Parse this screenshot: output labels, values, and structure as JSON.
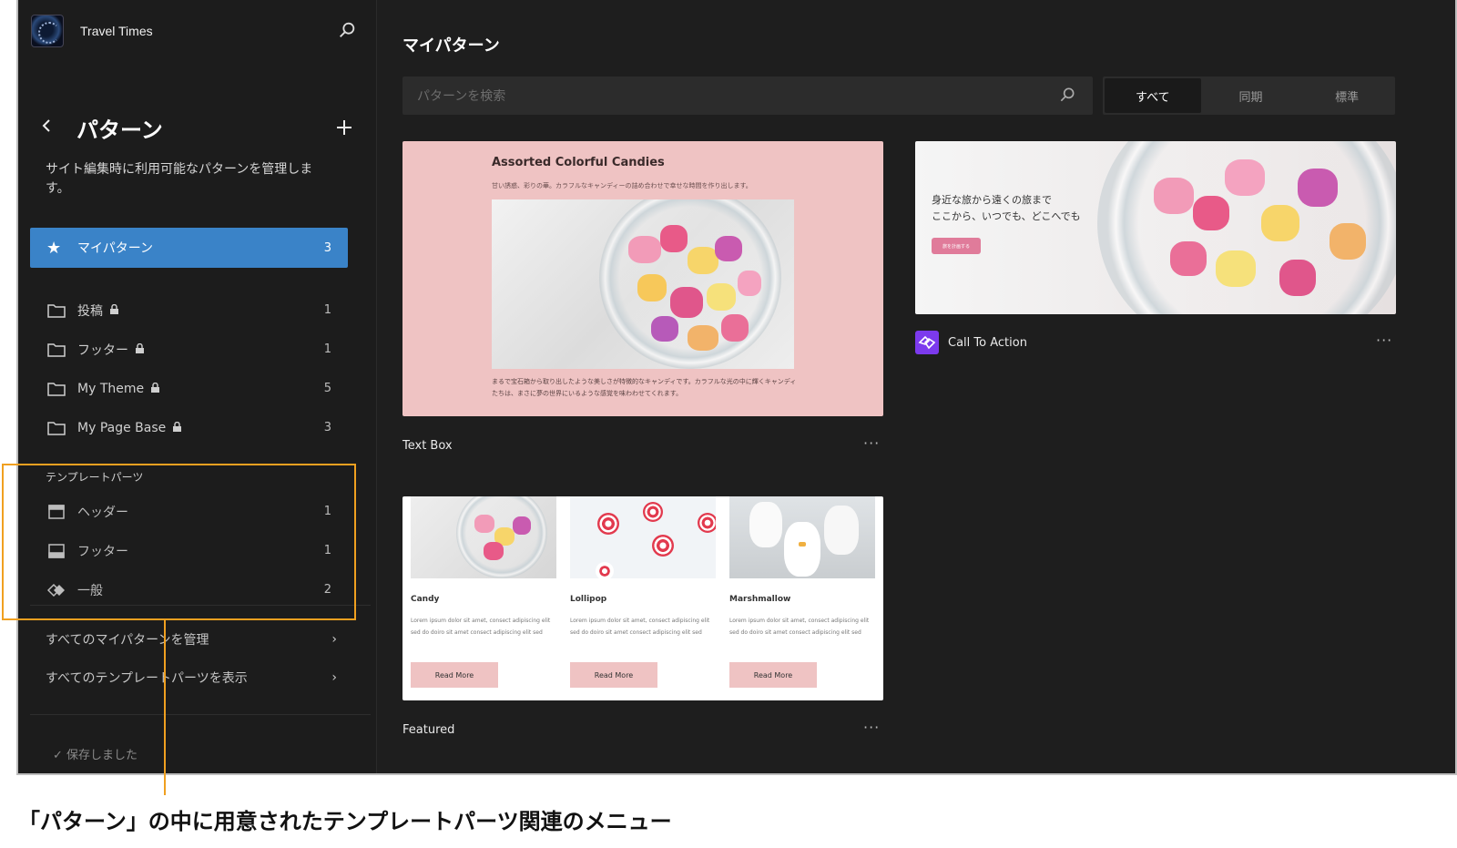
{
  "site": {
    "name": "Travel Times"
  },
  "panel": {
    "title": "パターン",
    "description": "サイト編集時に利用可能なパターンを管理します。"
  },
  "my_patterns": {
    "label": "マイパターン",
    "count": "3"
  },
  "categories": [
    {
      "label": "投稿",
      "count": "1",
      "locked": true
    },
    {
      "label": "フッター",
      "count": "1",
      "locked": true
    },
    {
      "label": "My Theme",
      "count": "5",
      "locked": true
    },
    {
      "label": "My Page Base",
      "count": "3",
      "locked": true
    }
  ],
  "template_parts": {
    "heading": "テンプレートパーツ",
    "items": [
      {
        "label": "ヘッダー",
        "count": "1",
        "icon": "header-icon"
      },
      {
        "label": "フッター",
        "count": "1",
        "icon": "footer-icon"
      },
      {
        "label": "一般",
        "count": "2",
        "icon": "general-icon"
      }
    ]
  },
  "links": {
    "manage_patterns": "すべてのマイパターンを管理",
    "view_template_parts": "すべてのテンプレートパーツを表示"
  },
  "saved_status": "保存しました",
  "main": {
    "title": "マイパターン",
    "search_placeholder": "パターンを検索",
    "filters": [
      "すべて",
      "同期",
      "標準"
    ],
    "active_filter": "すべて"
  },
  "cards": {
    "text_box": {
      "label": "Text Box",
      "preview_title": "Assorted Colorful Candies",
      "preview_subtitle": "甘い誘惑、彩りの華。カラフルなキャンディーの詰め合わせで幸せな時間を作り出します。",
      "preview_footer": "まるで宝石箱から取り出したような美しさが特徴的なキャンディです。カラフルな光の中に輝くキャンディたちは、まさに夢の世界にいるような感覚を味わわせてくれます。"
    },
    "call_to_action": {
      "label": "Call To Action",
      "preview_line1": "身近な旅から遠くの旅まで",
      "preview_line2": "ここから、いつでも、どこへでも",
      "preview_button": "旅を計画する"
    },
    "featured": {
      "label": "Featured",
      "items": [
        {
          "title": "Candy",
          "text": "Lorem ipsum dolor sit amet, consect adipiscing elit sed do doiro sit amet consect adipiscing elit sed",
          "button": "Read More"
        },
        {
          "title": "Lollipop",
          "text": "Lorem ipsum dolor sit amet, consect adipiscing elit sed do doiro sit amet consect adipiscing elit sed",
          "button": "Read More"
        },
        {
          "title": "Marshmallow",
          "text": "Lorem ipsum dolor sit amet, consect adipiscing elit sed do doiro sit amet consect adipiscing elit sed",
          "button": "Read More"
        }
      ]
    }
  },
  "annotation": {
    "caption": "「パターン」の中に用意されたテンプレートパーツ関連のメニュー",
    "color": "#f0a020"
  },
  "colors": {
    "accent": "#3a83c8",
    "sidebar_bg": "#1c1c1c",
    "main_bg": "#1e1e1e",
    "cta_icon": "#7c3aed"
  }
}
